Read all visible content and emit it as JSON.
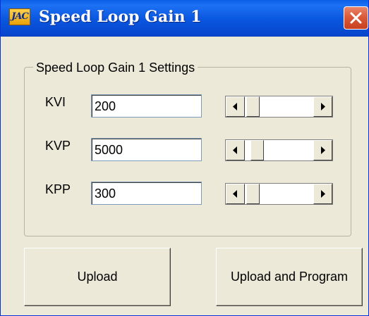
{
  "window": {
    "title": "Speed Loop Gain 1",
    "icon_text": "JAC",
    "icon": "app-logo-icon",
    "close_icon": "close-icon",
    "titlebar_color": "#0a56df",
    "close_color": "#dc5a39"
  },
  "group": {
    "label": "Speed Loop Gain 1 Settings"
  },
  "params": [
    {
      "label": "KVI",
      "value": "200"
    },
    {
      "label": "KVP",
      "value": "5000"
    },
    {
      "label": "KPP",
      "value": "300"
    }
  ],
  "buttons": {
    "upload": "Upload",
    "upload_program": "Upload and Program"
  }
}
